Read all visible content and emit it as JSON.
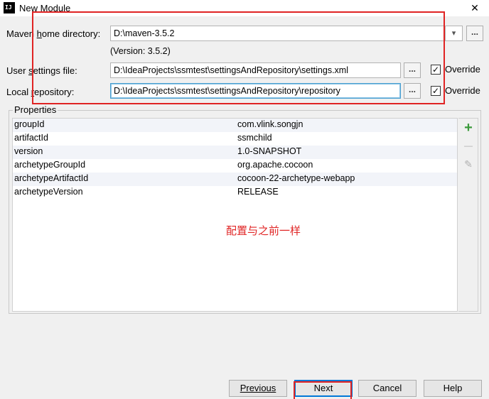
{
  "window": {
    "title": "New Module",
    "close_glyph": "✕"
  },
  "form": {
    "maven_home": {
      "label": "Maven home directory:",
      "value": "D:\\maven-3.5.2",
      "version": "(Version: 3.5.2)"
    },
    "user_settings": {
      "label": "User settings file:",
      "value": "D:\\IdeaProjects\\ssmtest\\settingsAndRepository\\settings.xml",
      "override_label": "Override",
      "override_checked": true
    },
    "local_repo": {
      "label": "Local repository:",
      "value": "D:\\IdeaProjects\\ssmtest\\settingsAndRepository\\repository",
      "override_label": "Override",
      "override_checked": true
    },
    "browse_label": "...",
    "check_glyph": "✓"
  },
  "properties": {
    "title": "Properties",
    "rows": [
      {
        "key": "groupId",
        "value": "com.vlink.songjn"
      },
      {
        "key": "artifactId",
        "value": "ssmchild"
      },
      {
        "key": "version",
        "value": "1.0-SNAPSHOT"
      },
      {
        "key": "archetypeGroupId",
        "value": "org.apache.cocoon"
      },
      {
        "key": "archetypeArtifactId",
        "value": "cocoon-22-archetype-webapp"
      },
      {
        "key": "archetypeVersion",
        "value": "RELEASE"
      }
    ],
    "tools": {
      "add": "+",
      "remove": "—",
      "edit": "✎"
    }
  },
  "annotation": {
    "text": "配置与之前一样",
    "color": "#e02424"
  },
  "buttons": {
    "previous": "Previous",
    "next": "Next",
    "cancel": "Cancel",
    "help": "Help"
  },
  "colors": {
    "accent": "#0078d7",
    "add_icon": "#3c9a3c"
  }
}
